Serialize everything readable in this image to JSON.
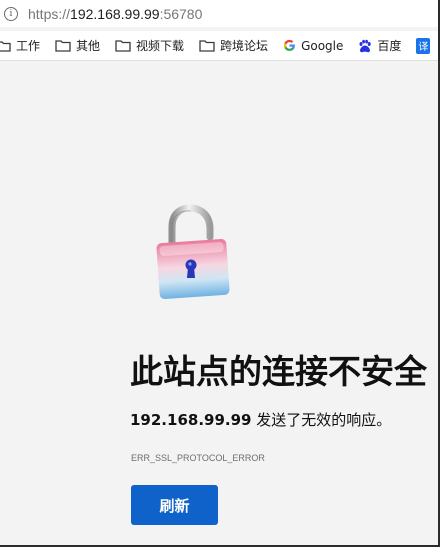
{
  "address_bar": {
    "url_scheme": "https://",
    "url_host": "192.168.99.99",
    "url_port": ":56780"
  },
  "bookmarks": [
    {
      "label": "工作",
      "icon": "folder-icon"
    },
    {
      "label": "其他",
      "icon": "folder-icon"
    },
    {
      "label": "视频下载",
      "icon": "folder-icon"
    },
    {
      "label": "跨境论坛",
      "icon": "folder-icon"
    },
    {
      "label": "Google",
      "icon": "google-icon"
    },
    {
      "label": "百度",
      "icon": "baidu-icon"
    },
    {
      "label": "译",
      "icon": "translate-icon"
    }
  ],
  "error_page": {
    "title": "此站点的连接不安全",
    "host_bold": "192.168.99.99",
    "description_rest": " 发送了无效的响应。",
    "error_code": "ERR_SSL_PROTOCOL_ERROR",
    "reload_button": "刷新"
  },
  "colors": {
    "button_blue": "#0f62c9",
    "page_background": "#f3f3f3"
  }
}
